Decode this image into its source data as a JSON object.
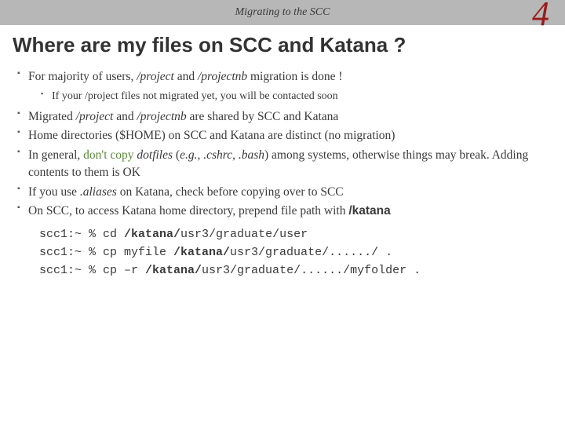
{
  "header": {
    "subtitle": "Migrating to the SCC",
    "page_number": "4"
  },
  "title": "Where are my files on SCC and Katana ?",
  "bullets": {
    "b1_a": "For majority of users, ",
    "b1_b": "/project ",
    "b1_c": " and ",
    "b1_d": "/projectnb ",
    "b1_e": " migration is done !",
    "b1_sub": "If your /project files not migrated yet, you will be contacted soon",
    "b2_a": "Migrated ",
    "b2_b": "/project ",
    "b2_c": " and ",
    "b2_d": "/projectnb ",
    "b2_e": " are shared by SCC and Katana",
    "b3": "Home directories ($HOME) on SCC and Katana  are distinct (no migration)",
    "b4_a": "In general, ",
    "b4_b": "don't copy ",
    "b4_c": "dotfiles ",
    "b4_d": "(",
    "b4_e": "e.g.",
    "b4_f": ", ",
    "b4_g": ".cshrc",
    "b4_h": ", ",
    "b4_i": ".bash",
    "b4_j": ") among systems, otherwise things may break. Adding contents to them is OK",
    "b5_a": "If you use ",
    "b5_b": ".aliases ",
    "b5_c": "on Katana, check before copying over to SCC",
    "b6_a": "On SCC, to access Katana home directory, prepend file path with ",
    "b6_b": "/katana"
  },
  "code": {
    "l1_a": "scc1:~ % cd ",
    "l1_b": "/katana/",
    "l1_c": "usr3/graduate/user",
    "l2_a": "scc1:~ % cp myfile ",
    "l2_b": "/katana/",
    "l2_c": "usr3/graduate/....../ .",
    "l3_a": "scc1:~ % cp –r ",
    "l3_b": "/katana/",
    "l3_c": "usr3/graduate/....../myfolder ."
  }
}
